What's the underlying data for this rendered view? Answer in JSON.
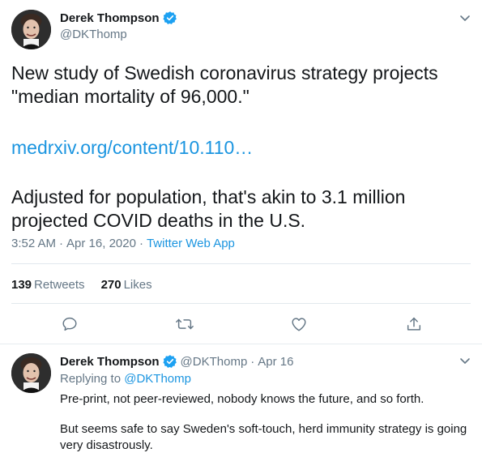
{
  "tweet": {
    "author_name": "Derek Thompson",
    "author_handle": "@DKThomp",
    "body_line1": "New study of Swedish coronavirus strategy projects",
    "body_line2": "\"median mortality of 96,000.\"",
    "link": "medrxiv.org/content/10.110…",
    "body_line3": "Adjusted for population, that's akin to 3.1 million",
    "body_line4": "projected COVID deaths in the U.S.",
    "time": "3:52 AM",
    "dot1": "·",
    "date": "Apr 16, 2020",
    "dot2": "·",
    "source": "Twitter Web App",
    "retweets_count": "139",
    "retweets_label": "Retweets",
    "likes_count": "270",
    "likes_label": "Likes"
  },
  "reply": {
    "author_name": "Derek Thompson",
    "author_handle": "@DKThomp",
    "dot": "·",
    "date": "Apr 16",
    "replying_prefix": "Replying to",
    "replying_to": "@DKThomp",
    "line1": "Pre-print, not peer-reviewed, nobody knows the future, and so forth.",
    "line2": "But seems safe to say Sweden's soft-touch, herd immunity strategy is going",
    "line3": "very disastrously."
  },
  "icons": {
    "verified": "verified-badge-icon",
    "chevron": "chevron-down-icon",
    "reply": "reply-icon",
    "retweet": "retweet-icon",
    "like": "heart-icon",
    "share": "share-icon"
  },
  "colors": {
    "link": "#1b95e0",
    "secondary_text": "#657786",
    "verified": "#1da1f2",
    "divider": "#e1e8ed"
  }
}
